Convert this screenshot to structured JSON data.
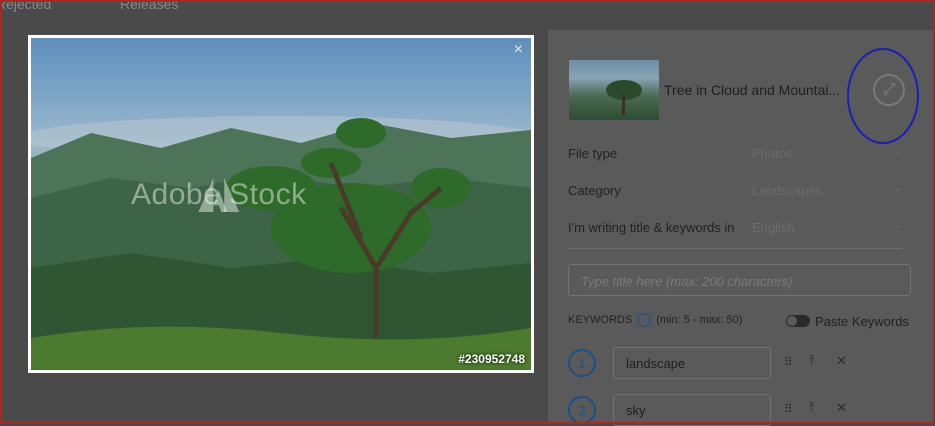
{
  "tabs": {
    "rejected": "Rejected",
    "releases": "Releases"
  },
  "preview": {
    "close_glyph": "×",
    "image_id": "#230952748",
    "watermark_text": "Adobe Stock"
  },
  "details": {
    "thumbnail_title": "Tree in Cloud and Mountai...",
    "expand_icon": "expand-icon",
    "fields": [
      {
        "label": "File type",
        "value": "Photos"
      },
      {
        "label": "Category",
        "value": "Landscapes"
      },
      {
        "label": "I'm writing title & keywords in",
        "value": "English"
      }
    ],
    "title_placeholder": "Type title here (max: 200 characters)",
    "keywords_label": "KEYWORDS",
    "keywords_range": "(min: 5 - max: 50)",
    "paste_keywords_label": "Paste Keywords",
    "keywords": [
      {
        "number": "1",
        "value": "landscape"
      },
      {
        "number": "2",
        "value": "sky"
      }
    ]
  },
  "colors": {
    "overlay": "#4a4a4a",
    "accent": "#1a4f8a",
    "annotation": "#1d1db8",
    "frame": "#b0261f"
  }
}
